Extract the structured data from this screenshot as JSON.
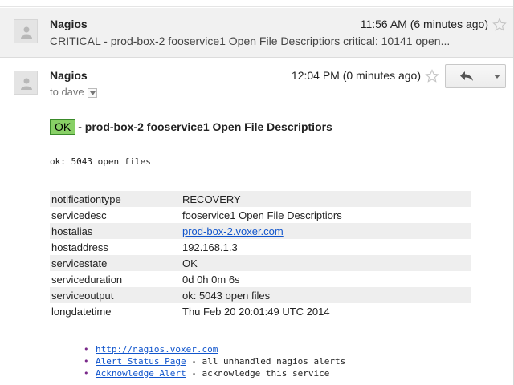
{
  "collapsed_message": {
    "sender": "Nagios",
    "time": "11:56 AM (6 minutes ago)",
    "snippet": "CRITICAL - prod-box-2 fooservice1 Open File Descriptiors critical: 10141 open..."
  },
  "open_message": {
    "sender": "Nagios",
    "to_label": "to dave",
    "time": "12:04 PM (0 minutes ago)",
    "status_badge": "OK",
    "subject": "- prod-box-2 fooservice1 Open File Descriptiors",
    "output": "ok: 5043 open files",
    "details": [
      {
        "key": "notificationtype",
        "value": "RECOVERY"
      },
      {
        "key": "servicedesc",
        "value": "fooservice1 Open File Descriptiors"
      },
      {
        "key": "hostalias",
        "value": "prod-box-2.voxer.com"
      },
      {
        "key": "hostaddress",
        "value": "192.168.1.3"
      },
      {
        "key": "servicestate",
        "value": "OK"
      },
      {
        "key": "serviceduration",
        "value": "0d 0h 0m 6s"
      },
      {
        "key": "serviceoutput",
        "value": "ok: 5043 open files"
      },
      {
        "key": "longdatetime",
        "value": "Thu Feb 20 20:01:49 UTC 2014"
      }
    ],
    "links": [
      {
        "link": "http://nagios.voxer.com",
        "desc": ""
      },
      {
        "link": "Alert Status Page",
        "desc": " - all unhandled nagios alerts"
      },
      {
        "link": "Acknowledge Alert",
        "desc": " - acknowledge this service"
      }
    ]
  },
  "colors": {
    "ok_green": "#88d066",
    "link_blue": "#1155cc",
    "collapsed_bg": "#f1f1f1"
  }
}
